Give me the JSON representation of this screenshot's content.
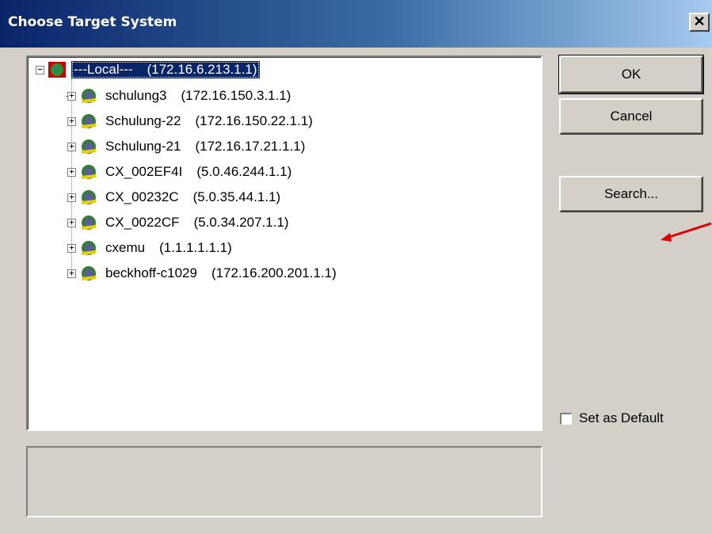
{
  "window": {
    "title": "Choose Target System",
    "close_label": "✕"
  },
  "tree": {
    "root": {
      "name": "---Local---",
      "address": "(172.16.6.213.1.1)",
      "expander": "−",
      "selected": true
    },
    "children": [
      {
        "name": "schulung3",
        "address": "(172.16.150.3.1.1)"
      },
      {
        "name": "Schulung-22",
        "address": "(172.16.150.22.1.1)"
      },
      {
        "name": "Schulung-21",
        "address": "(172.16.17.21.1.1)"
      },
      {
        "name": "CX_002EF4I",
        "address": "(5.0.46.244.1.1)"
      },
      {
        "name": "CX_00232C",
        "address": "(5.0.35.44.1.1)"
      },
      {
        "name": "CX_0022CF",
        "address": "(5.0.34.207.1.1)"
      },
      {
        "name": "cxemu",
        "address": "(1.1.1.1.1.1)"
      },
      {
        "name": "beckhoff-c1029",
        "address": "(172.16.200.201.1.1)"
      }
    ],
    "child_expander": "+"
  },
  "buttons": {
    "ok": "OK",
    "cancel": "Cancel",
    "search": "Search..."
  },
  "set_default": {
    "label": "Set as Default",
    "checked": false
  },
  "colors": {
    "selection": "#0a246a",
    "dialog_bg": "#d4d0c8",
    "outer_bg": "#c8c8f0",
    "arrow": "#e00000"
  }
}
